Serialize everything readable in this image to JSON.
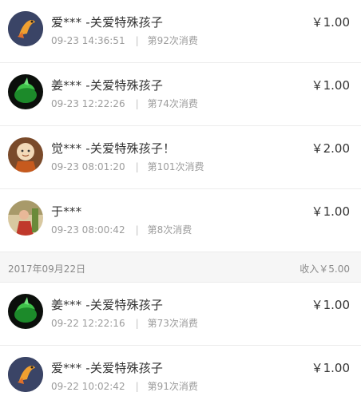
{
  "records_top": [
    {
      "name": "爱*** -关爱特殊孩子",
      "time": "09-23 14:36:51",
      "count": "第92次消费",
      "amount": "￥1.00",
      "avatar": "koi-fish-avatar-icon"
    },
    {
      "name": "姜*** -关爱特殊孩子",
      "time": "09-23 12:22:26",
      "count": "第74次消费",
      "amount": "￥1.00",
      "avatar": "green-plant-avatar-icon"
    },
    {
      "name": "觉*** -关爱特殊孩子！",
      "time": "09-23 08:01:20",
      "count": "第101次消费",
      "amount": "￥2.00",
      "avatar": "monk-doll-avatar-icon"
    },
    {
      "name": "于***",
      "time": "09-23 08:00:42",
      "count": "第8次消费",
      "amount": "￥1.00",
      "avatar": "person-photo-avatar-icon"
    }
  ],
  "day_header": {
    "date": "2017年09月22日",
    "income": "收入￥5.00"
  },
  "records_bottom": [
    {
      "name": "姜*** -关爱特殊孩子",
      "time": "09-22 12:22:16",
      "count": "第73次消费",
      "amount": "￥1.00",
      "avatar": "green-plant-avatar-icon"
    },
    {
      "name": "爱*** -关爱特殊孩子",
      "time": "09-22 10:02:42",
      "count": "第91次消费",
      "amount": "￥1.00",
      "avatar": "koi-fish-avatar-icon"
    }
  ],
  "meta_separator": "|",
  "colors": {
    "text": "#333333",
    "meta": "#9c9c9c",
    "divider": "#ececec",
    "header_bg": "#f6f6f6"
  }
}
